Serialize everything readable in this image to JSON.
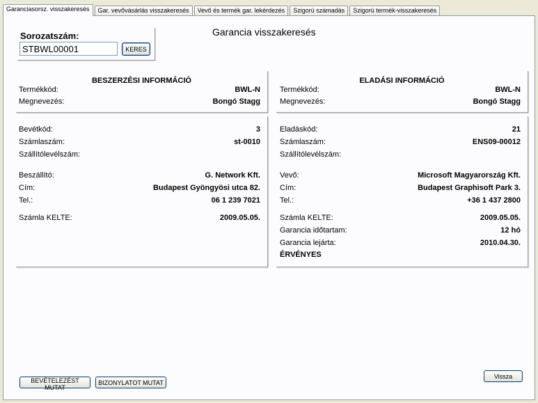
{
  "tabs": [
    {
      "label": "Garanciasorsz. visszakeresés"
    },
    {
      "label": "Gar. vevővásárlás visszakeresés"
    },
    {
      "label": "Vevő és termék gar. lekérdezés"
    },
    {
      "label": "Szigorú számadás"
    },
    {
      "label": "Szigorú termék-visszakeresés"
    }
  ],
  "search": {
    "label": "Sorozatszám:",
    "value": "STBWL00001",
    "button_label": "KERES"
  },
  "page_title": "Garancia visszakeresés",
  "purchase": {
    "title": "BESZERZÉSI INFORMÁCIÓ",
    "product_code_label": "Termékkód:",
    "product_code": "BWL-N",
    "name_label": "Megnevezés:",
    "name": "Bongó Stagg",
    "receipt_code_label": "Bevétkód:",
    "receipt_code": "3",
    "invoice_label": "Számlaszám:",
    "invoice": "st-0010",
    "delivery_label": "Szállítólevélszám:",
    "delivery": "",
    "supplier_label": "Beszállító:",
    "supplier": "G. Network Kft.",
    "address_label": "Cím:",
    "address": "Budapest Gyöngyösi utca 82.",
    "phone_label": "Tel.:",
    "phone": "06 1 239 7021",
    "date_label": "Számla KELTE:",
    "date": "2009.05.05."
  },
  "sales": {
    "title": "ELADÁSI INFORMÁCIÓ",
    "product_code_label": "Termékkód:",
    "product_code": "BWL-N",
    "name_label": "Megnevezés:",
    "name": "Bongó Stagg",
    "sale_code_label": "Eladáskód:",
    "sale_code": "21",
    "invoice_label": "Számlaszám:",
    "invoice": "ENS09-00012",
    "delivery_label": "Szállítólevélszám:",
    "delivery": "",
    "customer_label": "Vevő:",
    "customer": "Microsoft Magyarország Kft.",
    "address_label": "Cím:",
    "address": "Budapest Graphisoft Park 3.",
    "phone_label": "Tel.:",
    "phone": "+36 1 437 2800",
    "date_label": "Számla KELTE:",
    "date": "2009.05.05.",
    "warranty_duration_label": "Garancia időtartam:",
    "warranty_duration": "12 hó",
    "warranty_expiry_label": "Garancia lejárta:",
    "warranty_expiry": "2010.04.30.",
    "status": "ÉRVÉNYES"
  },
  "buttons": {
    "show_receipt": "BEVÉTELEZÉST MUTAT",
    "show_document": "BIZONYLATOT MUTAT",
    "back": "Vissza"
  }
}
